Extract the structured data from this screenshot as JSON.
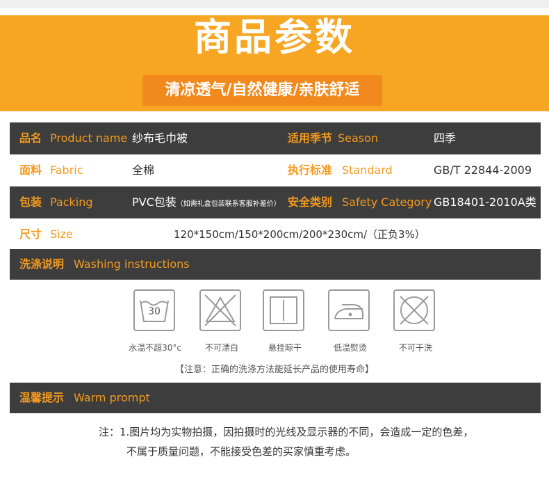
{
  "banner": {
    "title": "商品参数",
    "subtitle": "清凉透气/自然健康/亲肤舒适"
  },
  "params": {
    "product_name": {
      "cn": "品名",
      "en": "Product name",
      "value": "纱布毛巾被"
    },
    "season": {
      "cn": "适用季节",
      "en": "Season",
      "value": "四季"
    },
    "fabric": {
      "cn": "面料",
      "en": "Fabric",
      "value": "全棉"
    },
    "standard": {
      "cn": "执行标准",
      "en": "Standard",
      "value": "GB/T 22844-2009"
    },
    "packing": {
      "cn": "包装",
      "en": "Packing",
      "value": "PVC包装",
      "value_note": "（如需礼盒包装联系客服补差价）"
    },
    "safety": {
      "cn": "安全类别",
      "en": "Safety Category",
      "value": "GB18401-2010A类"
    },
    "size": {
      "cn": "尺寸",
      "en": "Size",
      "value": "120*150cm/150*200cm/200*230cm/（正负3%）"
    }
  },
  "washing": {
    "cn": "洗涤说明",
    "en": "Washing instructions",
    "icons": [
      {
        "icon": "wash-30-icon",
        "number": "30",
        "label": "水温不超30°c"
      },
      {
        "icon": "no-bleach-icon",
        "label": "不可漂白"
      },
      {
        "icon": "hang-dry-icon",
        "label": "悬挂晾干"
      },
      {
        "icon": "low-iron-icon",
        "label": "低温熨烫"
      },
      {
        "icon": "no-dry-clean-icon",
        "label": "不可干洗"
      }
    ],
    "note": "【注意：正确的洗涤方法能延长产品的使用寿命】"
  },
  "warm": {
    "cn": "温馨提示",
    "en": "Warm prompt",
    "line1": "注：1.图片均为实物拍摄，因拍摄时的光线及显示器的不同，会造成一定的色差，",
    "line2": "不属于质量问题，不能接受色差的买家慎重考虑。"
  },
  "colors": {
    "accent": "#f7a624",
    "accent_dark": "#f1891c",
    "dark_row": "#3d3d3d",
    "label": "#f59a1c"
  }
}
